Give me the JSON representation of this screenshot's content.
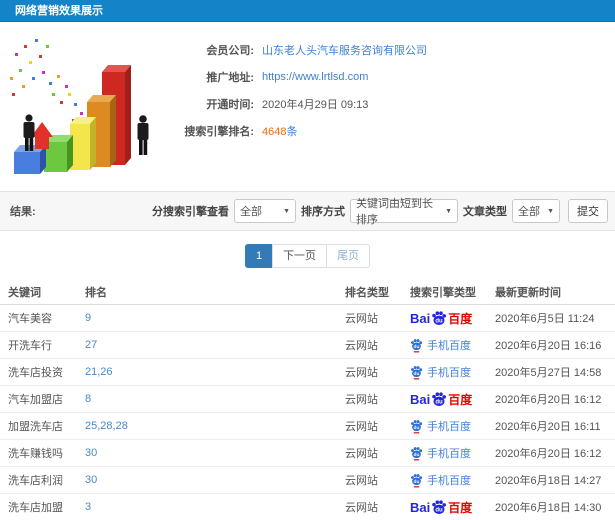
{
  "header": {
    "title": "网络营销效果展示"
  },
  "info": {
    "rows": [
      {
        "label": "会员公司:",
        "value": "山东老人头汽车服务咨询有限公司"
      },
      {
        "label": "推广地址:",
        "value": "https://www.lrtlsd.com"
      },
      {
        "label": "开通时间:",
        "value": "2020年4月29日 09:13"
      },
      {
        "label": "搜索引擎排名:",
        "value": "4648",
        "suffix": "条"
      }
    ]
  },
  "filters": {
    "result_label": "结果:",
    "engine_label": "分搜索引擎查看",
    "engine_value": "全部",
    "sort_label": "排序方式",
    "sort_value": "关键词由短到长排序",
    "article_label": "文章类型",
    "article_value": "全部",
    "submit_label": "提交"
  },
  "pagination": {
    "current": "1",
    "next": "下一页",
    "last": "尾页"
  },
  "table": {
    "headers": [
      "关键词",
      "排名",
      "排名类型",
      "搜索引擎类型",
      "最新更新时间"
    ],
    "engine_labels": {
      "baidu_bai": "Bai",
      "baidu_du": "du",
      "baidu_cn": "百度",
      "mobile": "手机百度"
    },
    "rows": [
      {
        "keyword": "汽车美容",
        "rank": "9",
        "rank_type": "云网站",
        "engine": "baidu",
        "time": "2020年6月5日 11:24"
      },
      {
        "keyword": "开洗车行",
        "rank": "27",
        "rank_type": "云网站",
        "engine": "mobile-baidu",
        "time": "2020年6月20日 16:16"
      },
      {
        "keyword": "洗车店投资",
        "rank": "21,26",
        "rank_type": "云网站",
        "engine": "mobile-baidu",
        "time": "2020年5月27日 14:58"
      },
      {
        "keyword": "汽车加盟店",
        "rank": "8",
        "rank_type": "云网站",
        "engine": "baidu",
        "time": "2020年6月20日 16:12"
      },
      {
        "keyword": "加盟洗车店",
        "rank": "25,28,28",
        "rank_type": "云网站",
        "engine": "mobile-baidu",
        "time": "2020年6月20日 16:11"
      },
      {
        "keyword": "洗车赚钱吗",
        "rank": "30",
        "rank_type": "云网站",
        "engine": "mobile-baidu",
        "time": "2020年6月20日 16:12"
      },
      {
        "keyword": "洗车店利润",
        "rank": "30",
        "rank_type": "云网站",
        "engine": "mobile-baidu",
        "time": "2020年6月18日 14:27"
      },
      {
        "keyword": "洗车店加盟",
        "rank": "3",
        "rank_type": "云网站",
        "engine": "baidu",
        "time": "2020年6月18日 14:30"
      }
    ]
  },
  "colors": {
    "header_bg": "#1483c8",
    "link_blue": "#3d7fd0",
    "rank_blue": "#4a86c8",
    "count_orange": "#ff6600",
    "pagination_active": "#337ab7",
    "baidu_blue": "#2326dc",
    "baidu_red": "#e10601",
    "mobile_baidu_blue": "#3f81d8",
    "illustration_bars": [
      "#4a7de0",
      "#6cc93f",
      "#f2e64b",
      "#dd8a20",
      "#ce2823"
    ],
    "illustration_arrow": "#e03228"
  }
}
